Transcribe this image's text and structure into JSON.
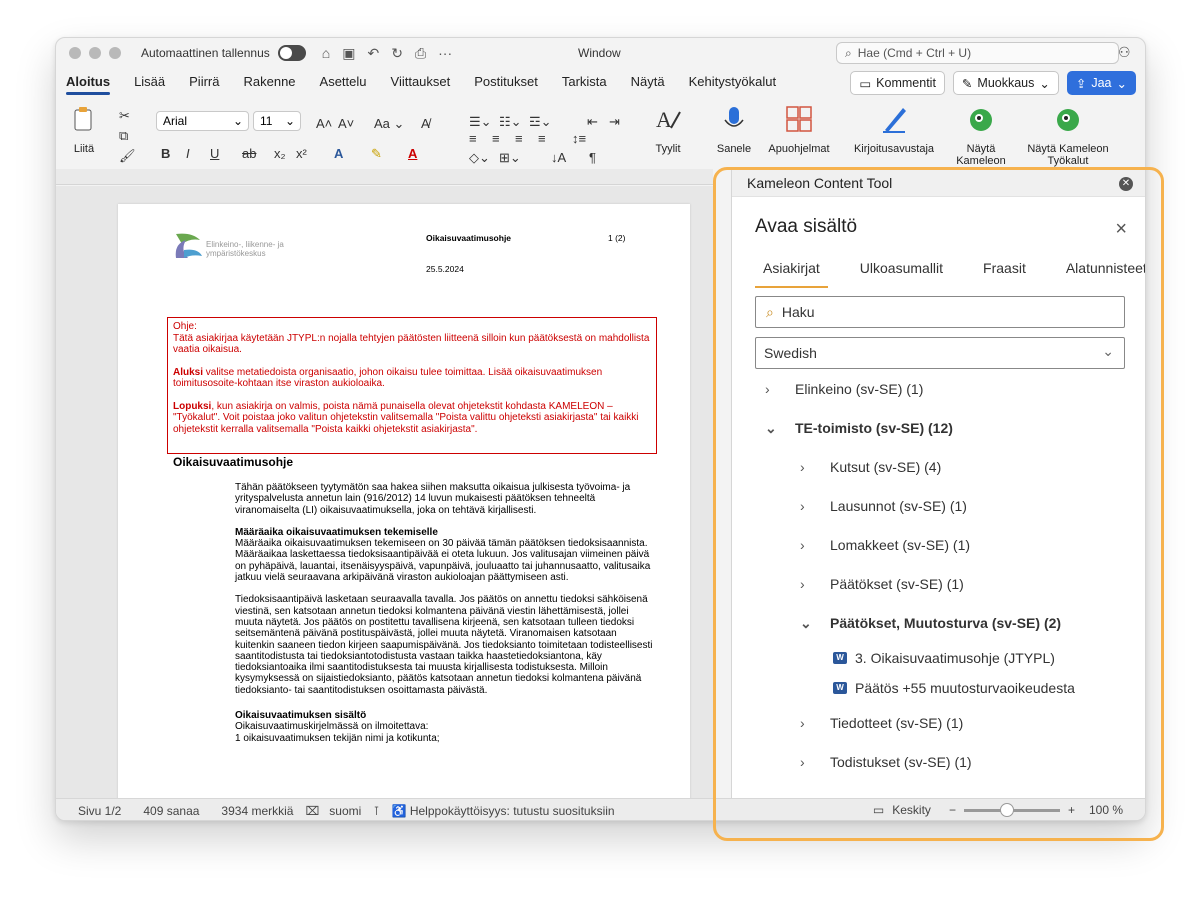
{
  "titlebar": {
    "autosave_label": "Automaattinen tallennus",
    "window_title": "Window",
    "search_placeholder": "Hae (Cmd + Ctrl + U)"
  },
  "ribbon": {
    "tabs": [
      "Aloitus",
      "Lisää",
      "Piirrä",
      "Rakenne",
      "Asettelu",
      "Viittaukset",
      "Postitukset",
      "Tarkista",
      "Näytä",
      "Kehitystyökalut"
    ],
    "active_tab": "Aloitus",
    "comments_label": "Kommentit",
    "editing_label": "Muokkaus",
    "share_label": "Jaa",
    "paste_label": "Liitä",
    "font_name": "Arial",
    "font_size": "11",
    "styles_label": "Tyylit",
    "dictate_label": "Sanele",
    "addins_label": "Apuohjelmat",
    "writer_label": "Kirjoitusavustaja",
    "show_kameleon_label": "Näytä Kameleon",
    "show_kameleon_tools_label": "Näytä Kameleon Työkalut"
  },
  "document": {
    "logo_line1": "Elinkeino-, liikenne- ja",
    "logo_line2": "ympäristökeskus",
    "header_title": "Oikaisuvaatimusohje",
    "header_page": "1 (2)",
    "header_date": "25.5.2024",
    "red_box": {
      "p1": "Ohje:\nTätä asiakirjaa käytetään JTYPL:n nojalla tehtyjen päätösten liitteenä silloin kun päätöksestä on mahdollista vaatia oikaisua.",
      "p2_bold": "Aluksi",
      "p2": " valitse metatiedoista organisaatio, johon oikaisu tulee toimittaa. Lisää oikaisuvaatimuksen toimitusosoite-kohtaan itse viraston aukioloaika.",
      "p3_bold": "Lopuksi",
      "p3": ", kun asiakirja on valmis, poista nämä punaisella olevat ohjetekstit kohdasta KAMELEON – \"Työkalut\". Voit poistaa joko valitun ohjetekstin valitsemalla \"Poista valittu ohjeteksti asiakirjasta\" tai kaikki ohjetekstit kerralla valitsemalla \"Poista kaikki ohjetekstit asiakirjasta\"."
    },
    "heading": "Oikaisuvaatimusohje",
    "para1": "Tähän päätökseen tyytymätön saa hakea siihen maksutta oikaisua julkisesta työvoima- ja yrityspalvelusta annetun lain (916/2012) 14 luvun mukaisesti päätöksen tehneeltä viranomaiselta (LI) oikaisuvaatimuksella, joka on tehtävä kirjallisesti.",
    "sub1": "Määräaika oikaisuvaatimuksen tekemiselle",
    "para2": "Määräaika oikaisuvaatimuksen tekemiseen on 30 päivää tämän päätöksen tiedoksisaannista. Määräaikaa laskettaessa tiedoksisaantipäivää ei oteta lukuun. Jos valitusajan viimeinen päivä on pyhäpäivä, lauantai, itsenäisyyspäivä, vapunpäivä, jouluaatto tai juhannusaatto, valitusaika jatkuu vielä seuraavana arkipäivänä viraston aukioloajan päättymiseen asti.",
    "para3": "Tiedoksisaantipäivä lasketaan seuraavalla tavalla. Jos päätös on annettu tiedoksi sähköisenä viestinä, sen katsotaan annetun tiedoksi kolmantena päivänä viestin lähettämisestä, jollei muuta näytetä. Jos päätös on postitettu tavallisena kirjeenä, sen katsotaan tulleen tiedoksi seitsemäntenä päivänä postituspäivästä, jollei muuta näytetä. Viranomaisen katsotaan kuitenkin saaneen tiedon kirjeen saapumispäivänä. Jos tiedoksianto toimitetaan todisteellisesti saantitodistusta tai tiedoksiantotodistusta vastaan taikka haastetiedoksiantona, käy tiedoksiantoaika ilmi saantitodistuksesta tai muusta kirjallisesta todistuksesta. Milloin kysymyksessä on sijaistiedoksianto, päätös katsotaan annetun tiedoksi kolmantena päivänä tiedoksianto- tai saantitodistuksen osoittamasta päivästä.",
    "sub2": "Oikaisuvaatimuksen sisältö",
    "para4": "Oikaisuvaatimuskirjelmässä on ilmoitettava:",
    "list1": "1   oikaisuvaatimuksen tekijän nimi ja kotikunta;"
  },
  "statusbar": {
    "page": "Sivu 1/2",
    "words": "409 sanaa",
    "chars": "3934 merkkiä",
    "lang": "suomi",
    "accessibility": "Helppokäyttöisyys: tutustu suosituksiin",
    "focus": "Keskity",
    "zoom": "100 %",
    "zoom_level": 0.45
  },
  "panel": {
    "header": "Kameleon Content Tool",
    "title": "Avaa sisältö",
    "tabs": [
      "Asiakirjat",
      "Ulkoasumallit",
      "Fraasit",
      "Alatunnisteet"
    ],
    "active_tab": "Asiakirjat",
    "search_placeholder": "Haku",
    "language": "Swedish",
    "tree": [
      {
        "label": "Elinkeino (sv-SE) (1)",
        "expanded": false,
        "level": 0
      },
      {
        "label": "TE-toimisto (sv-SE) (12)",
        "expanded": true,
        "level": 0
      },
      {
        "label": "Kutsut (sv-SE) (4)",
        "expanded": false,
        "level": 1
      },
      {
        "label": "Lausunnot (sv-SE) (1)",
        "expanded": false,
        "level": 1
      },
      {
        "label": "Lomakkeet (sv-SE) (1)",
        "expanded": false,
        "level": 1
      },
      {
        "label": "Päätökset (sv-SE) (1)",
        "expanded": false,
        "level": 1
      },
      {
        "label": "Päätökset, Muutosturva (sv-SE) (2)",
        "expanded": true,
        "level": 1
      },
      {
        "label": "3. Oikaisuvaatimusohje (JTYPL)",
        "doc": true,
        "level": 2
      },
      {
        "label": "Päätös +55 muutosturvaoikeudesta",
        "doc": true,
        "level": 2
      },
      {
        "label": "Tiedotteet (sv-SE) (1)",
        "expanded": false,
        "level": 1
      },
      {
        "label": "Todistukset (sv-SE) (1)",
        "expanded": false,
        "level": 1
      }
    ]
  },
  "colors": {
    "accent": "#2f6fdc",
    "highlight": "#f6b24e",
    "instruction_red": "#c00000"
  }
}
